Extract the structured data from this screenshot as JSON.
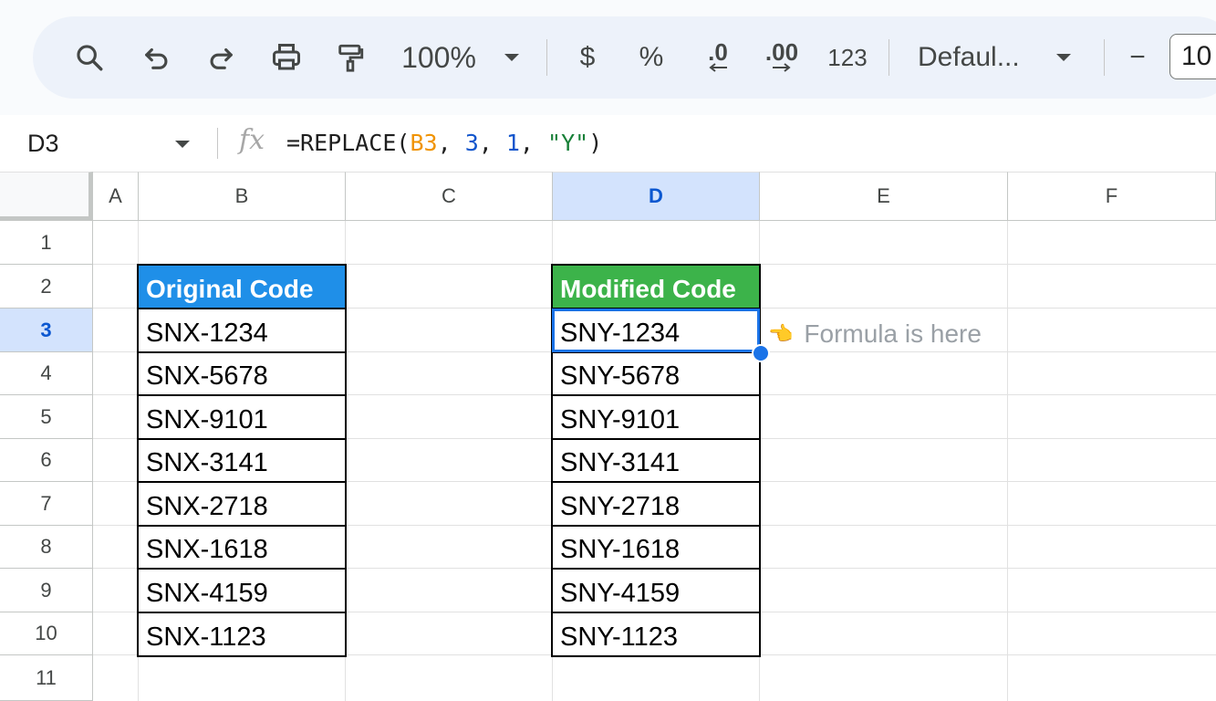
{
  "toolbar": {
    "zoom": "100%",
    "currency": "$",
    "percent": "%",
    "decrease_decimal": ".0",
    "increase_decimal": ".00",
    "number_format": "123",
    "font": "Defaul...",
    "decrease_font_size": "−",
    "font_size": "10",
    "icons": [
      "search-icon",
      "undo-icon",
      "redo-icon",
      "print-icon",
      "paint-format-icon",
      "chevron-down-icon"
    ]
  },
  "formula_bar": {
    "name_box": "D3",
    "fx": "fx",
    "formula_prefix": "=REPLACE(",
    "formula_ref": "B3",
    "formula_sep1": ", ",
    "formula_arg2": "3",
    "formula_sep2": ", ",
    "formula_arg3": "1",
    "formula_sep3": ", ",
    "formula_arg4": "\"Y\"",
    "formula_suffix": ")"
  },
  "columns": [
    "A",
    "B",
    "C",
    "D",
    "E",
    "F"
  ],
  "rows": [
    "1",
    "2",
    "3",
    "4",
    "5",
    "6",
    "7",
    "8",
    "9",
    "10",
    "11"
  ],
  "selected_cell": "D3",
  "table": {
    "original_header": "Original Code",
    "modified_header": "Modified Code",
    "original": [
      "SNX-1234",
      "SNX-5678",
      "SNX-9101",
      "SNX-3141",
      "SNX-2718",
      "SNX-1618",
      "SNX-4159",
      "SNX-1123"
    ],
    "modified": [
      "SNY-1234",
      "SNY-5678",
      "SNY-9101",
      "SNY-3141",
      "SNY-2718",
      "SNY-1618",
      "SNY-4159",
      "SNY-1123"
    ]
  },
  "note": {
    "emoji": "👈",
    "text": "Formula is here"
  },
  "colors": {
    "header_blue": "#1f8fe8",
    "header_green": "#3cb34a",
    "selection": "#1a73e8"
  }
}
